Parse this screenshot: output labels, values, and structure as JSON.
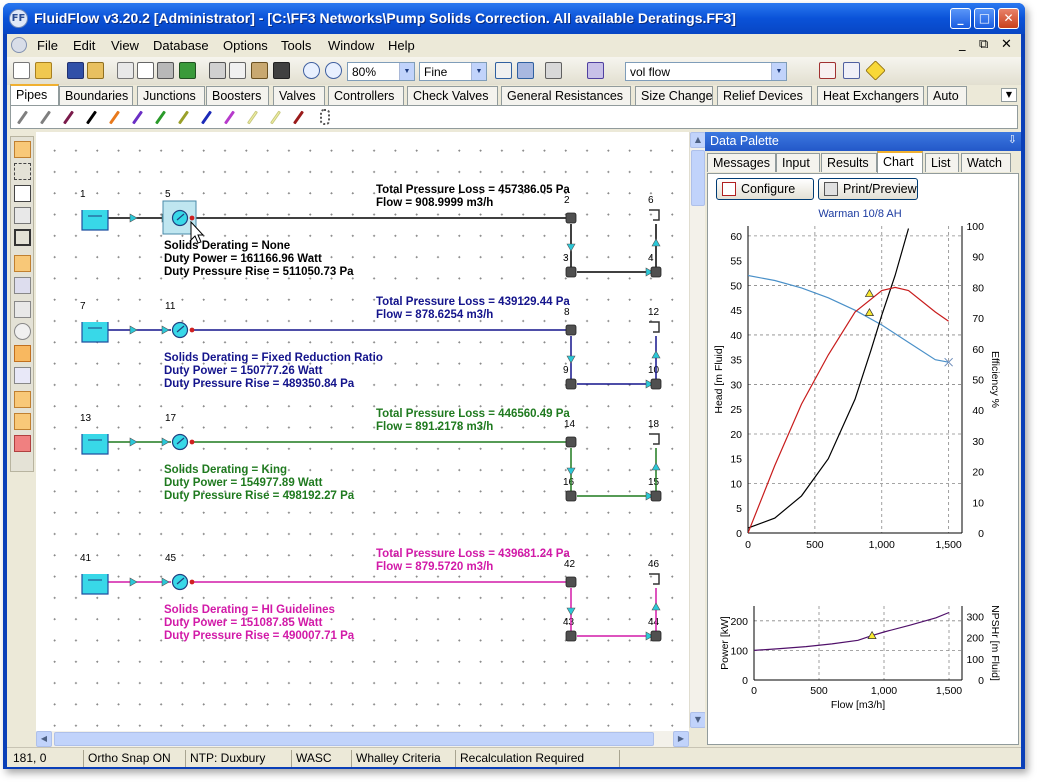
{
  "window": {
    "title": "FluidFlow v3.20.2 [Administrator] - [C:\\FF3 Networks\\Pump Solids Correction. All available Deratings.FF3]",
    "icon_label": "FF",
    "buttons": {
      "minimize": "_",
      "maximize": "□",
      "close": "✕"
    }
  },
  "menubar": {
    "items": [
      "File",
      "Edit",
      "View",
      "Database",
      "Options",
      "Tools",
      "Window",
      "Help"
    ],
    "mdi_controls": [
      "_",
      "⧉",
      "✕"
    ]
  },
  "toolbar": {
    "zoom": "80%",
    "grid": "Fine",
    "display_field": "vol flow",
    "icons": [
      "new-icon",
      "open-icon",
      "save-icon",
      "save-all-icon",
      "properties-icon",
      "print-preview-icon",
      "print-icon",
      "export-icon",
      "cut-icon",
      "copy-icon",
      "paste-icon",
      "find-icon",
      "zoom-in-icon",
      "zoom-out-icon"
    ]
  },
  "component_tabs": {
    "items": [
      "Pipes",
      "Boundaries",
      "Junctions",
      "Boosters",
      "Valves",
      "Controllers",
      "Check Valves",
      "General Resistances",
      "Size Change",
      "Relief Devices",
      "Heat Exchangers",
      "Auto"
    ],
    "active": "Pipes",
    "pipe_colors": [
      "#7f7f7f",
      "#7f7f7f",
      "#7a1a4a",
      "#000000",
      "#e8791c",
      "#6a2ec4",
      "#2a9a2a",
      "#9aa02a",
      "#1c2ab8",
      "#b63acb",
      "#f0f0a0",
      "#f0f0a0",
      "#9a1a1a"
    ]
  },
  "networks": [
    {
      "color": "#000000",
      "nodes": {
        "tank": "1",
        "pump": "5",
        "top_right": "2",
        "bottom_left": "3",
        "bottom_right": "4",
        "far_right": "6"
      },
      "total_pressure_loss": "Total Pressure Loss = 457386.05 Pa",
      "flow": "Flow = 908.9999 m3/h",
      "derating": "Solids Derating = None",
      "duty_power": "Duty Power = 161166.96 Watt",
      "duty_pressure_rise": "Duty Pressure Rise = 511050.73 Pa"
    },
    {
      "color": "#14148c",
      "nodes": {
        "tank": "7",
        "pump": "11",
        "top_right": "8",
        "bottom_left": "9",
        "bottom_right": "10",
        "far_right": "12"
      },
      "total_pressure_loss": "Total Pressure Loss = 439129.44 Pa",
      "flow": "Flow = 878.6254 m3/h",
      "derating": "Solids Derating = Fixed Reduction Ratio",
      "duty_power": "Duty Power = 150777.26 Watt",
      "duty_pressure_rise": "Duty Pressure Rise = 489350.84 Pa"
    },
    {
      "color": "#1f7a1f",
      "nodes": {
        "tank": "13",
        "pump": "17",
        "top_right": "14",
        "bottom_left": "16",
        "bottom_right": "15",
        "far_right": "18"
      },
      "total_pressure_loss": "Total Pressure Loss = 446560.49 Pa",
      "flow": "Flow = 891.2178 m3/h",
      "derating": "Solids Derating = King",
      "duty_power": "Duty Power = 154977.89 Watt",
      "duty_pressure_rise": "Duty Pressure Rise = 498192.27 Pa"
    },
    {
      "color": "#d21aa8",
      "nodes": {
        "tank": "41",
        "pump": "45",
        "top_right": "42",
        "bottom_left": "43",
        "bottom_right": "44",
        "far_right": "46"
      },
      "total_pressure_loss": "Total Pressure Loss = 439681.24 Pa",
      "flow": "Flow = 879.5720 m3/h",
      "derating": "Solids Derating = HI Guidelines",
      "duty_power": "Duty Power = 151087.85 Watt",
      "duty_pressure_rise": "Duty Pressure Rise = 490007.71 Pa"
    }
  ],
  "palette": {
    "title": "Data Palette",
    "pin": "⇩",
    "tabs": [
      "Messages",
      "Input",
      "Results",
      "Chart",
      "List",
      "Watch"
    ],
    "active_tab": "Chart",
    "configure": "Configure",
    "print_preview": "Print/Preview"
  },
  "chart_data": [
    {
      "type": "line",
      "title": "Warman 10/8 AH",
      "xlabel": "",
      "ylabel": "Head [m Fluid]",
      "y2label": "Efficiency %",
      "xlim": [
        0,
        1600
      ],
      "ylim": [
        0,
        62
      ],
      "y2lim": [
        0,
        100
      ],
      "x_ticks": [
        "0",
        "500",
        "1,000",
        "1,500"
      ],
      "y_ticks": [
        "0",
        "5",
        "10",
        "15",
        "20",
        "25",
        "30",
        "35",
        "40",
        "45",
        "50",
        "55",
        "60"
      ],
      "y2_ticks": [
        "0",
        "10",
        "20",
        "30",
        "40",
        "50",
        "60",
        "70",
        "80",
        "90",
        "100"
      ],
      "grid": true,
      "series": [
        {
          "color": "#4a90c8",
          "axis": "left",
          "points": [
            [
              0,
              52
            ],
            [
              200,
              51
            ],
            [
              400,
              49.5
            ],
            [
              600,
              47.5
            ],
            [
              800,
              45
            ],
            [
              1000,
              42
            ],
            [
              1200,
              38.5
            ],
            [
              1400,
              35
            ],
            [
              1500,
              34.5
            ]
          ]
        },
        {
          "color": "#000000",
          "axis": "left",
          "points": [
            [
              0,
              1
            ],
            [
              200,
              3
            ],
            [
              400,
              7.5
            ],
            [
              600,
              15
            ],
            [
              800,
              27
            ],
            [
              920,
              37
            ],
            [
              1000,
              44
            ],
            [
              1100,
              52
            ],
            [
              1200,
              61.5
            ]
          ]
        },
        {
          "color": "#c81c1c",
          "axis": "right",
          "points": [
            [
              0,
              0
            ],
            [
              200,
              22
            ],
            [
              400,
              42
            ],
            [
              600,
              58
            ],
            [
              800,
              72
            ],
            [
              1000,
              79
            ],
            [
              1100,
              80
            ],
            [
              1200,
              79
            ],
            [
              1400,
              72
            ],
            [
              1500,
              69
            ]
          ]
        }
      ],
      "markers": [
        {
          "x": 908,
          "y": 44.5,
          "axis": "left",
          "shape": "triangle"
        },
        {
          "x": 908,
          "y": 78,
          "axis": "right",
          "shape": "triangle"
        },
        {
          "x": 1500,
          "y": 34.5,
          "axis": "left",
          "shape": "cross"
        }
      ]
    },
    {
      "type": "line",
      "title": "",
      "xlabel": "Flow [m3/h]",
      "ylabel": "Power [kW]",
      "y2label": "NPSHr [m Fluid]",
      "xlim": [
        0,
        1600
      ],
      "ylim": [
        0,
        250
      ],
      "y2lim": [
        0,
        350
      ],
      "x_ticks": [
        "0",
        "500",
        "1,000",
        "1,500"
      ],
      "y_ticks": [
        "0",
        "100",
        "200"
      ],
      "y2_ticks": [
        "0",
        "100",
        "200",
        "300"
      ],
      "grid": true,
      "series": [
        {
          "color": "#50106a",
          "axis": "left",
          "points": [
            [
              0,
              100
            ],
            [
              200,
              106
            ],
            [
              400,
              113
            ],
            [
              600,
              122
            ],
            [
              800,
              134
            ],
            [
              908,
              150
            ],
            [
              1000,
              162
            ],
            [
              1200,
              185
            ],
            [
              1400,
              210
            ],
            [
              1500,
              228
            ]
          ]
        }
      ],
      "markers": [
        {
          "x": 908,
          "y": 150,
          "axis": "left",
          "shape": "triangle"
        }
      ]
    }
  ],
  "statusbar": [
    "181, 0",
    "Ortho Snap ON",
    "NTP: Duxbury",
    "WASC",
    "Whalley Criteria",
    "Recalculation Required"
  ]
}
